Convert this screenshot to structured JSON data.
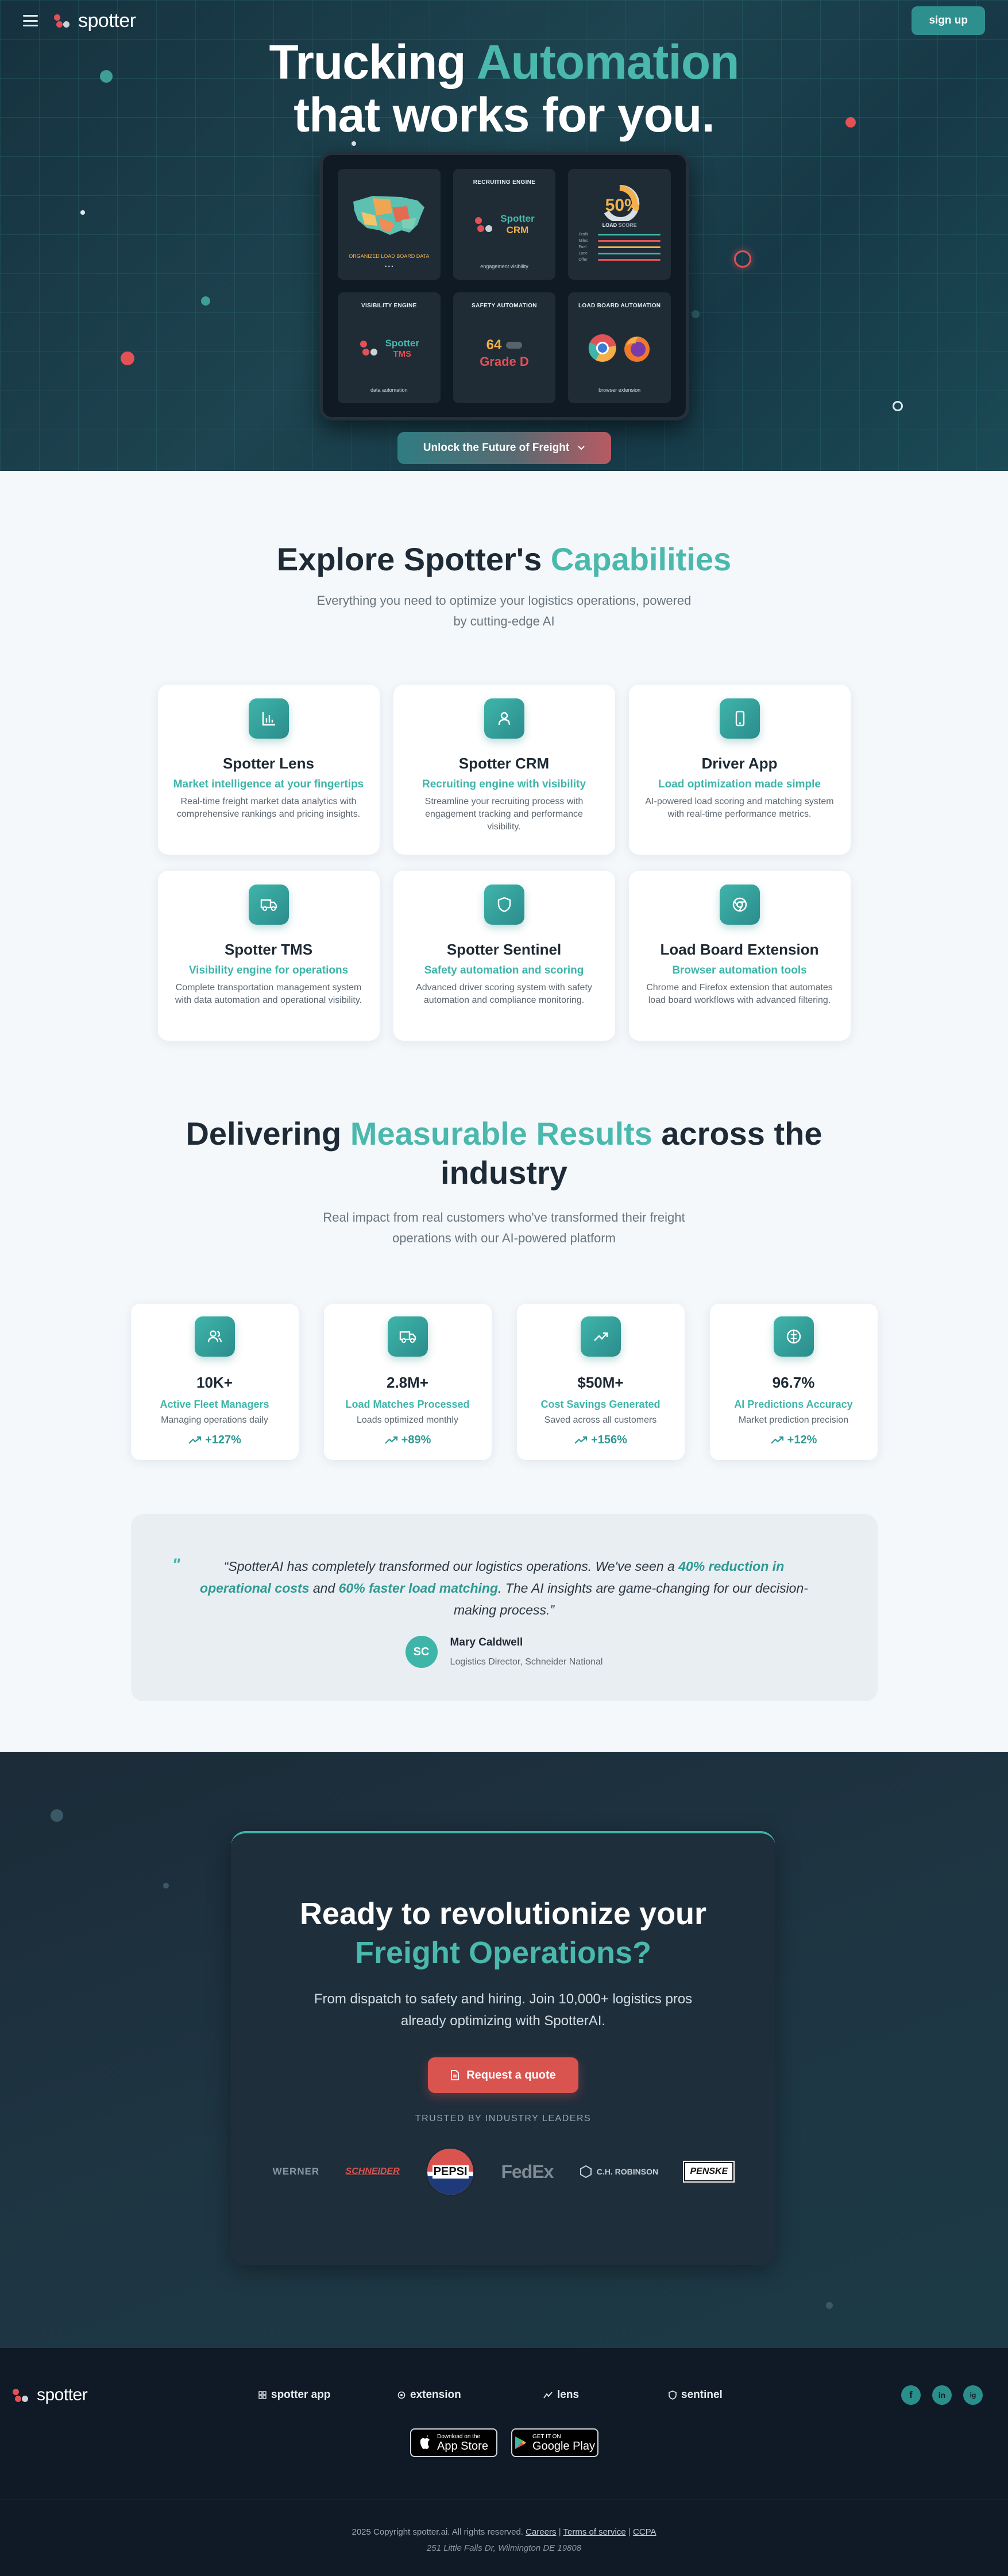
{
  "header": {
    "brand": "spotter",
    "signup_label": "sign up"
  },
  "hero": {
    "title_line1_plain": "Trucking ",
    "title_line1_accent": "Automation",
    "title_line2": "that works for you.",
    "cta_label": "Unlock the Future of Freight",
    "tablet_cards": [
      {
        "title": "",
        "foot": "ORGANIZED LOAD BOARD DATA",
        "foot2": "• • •"
      },
      {
        "title": "RECRUITING ENGINE",
        "logo_a": "Spotter",
        "logo_b": "CRM",
        "foot": "engagement visibility"
      },
      {
        "title": "",
        "pct": "50%",
        "load_label": "LOAD",
        "score_label": "SCORE",
        "rows": [
          "Profit",
          "Miles",
          "Fuel",
          "Lane",
          "Offer"
        ]
      },
      {
        "title": "VISIBILITY ENGINE",
        "logo_a": "Spotter",
        "logo_b": "TMS",
        "foot": "data automation"
      },
      {
        "title": "SAFETY AUTOMATION",
        "score": "64",
        "grade": "Grade D"
      },
      {
        "title": "LOAD BOARD AUTOMATION",
        "foot": "browser extension"
      }
    ]
  },
  "capabilities": {
    "title_plain": "Explore Spotter's ",
    "title_accent": "Capabilities",
    "subtitle_line1": "Everything you need to optimize your logistics operations, powered",
    "subtitle_line2": "by cutting-edge AI",
    "cards": [
      {
        "name": "Spotter Lens",
        "tag": "Market intelligence at your fingertips",
        "desc": "Real-time freight market data analytics with comprehensive rankings and pricing insights.",
        "icon": "bar-chart-icon"
      },
      {
        "name": "Spotter CRM",
        "tag": "Recruiting engine with visibility",
        "desc": "Streamline your recruiting process with engagement tracking and performance visibility.",
        "icon": "user-icon"
      },
      {
        "name": "Driver App",
        "tag": "Load optimization made simple",
        "desc": "AI-powered load scoring and matching system with real-time performance metrics.",
        "icon": "phone-icon"
      },
      {
        "name": "Spotter TMS",
        "tag": "Visibility engine for operations",
        "desc": "Complete transportation management system with data automation and operational visibility.",
        "icon": "truck-icon"
      },
      {
        "name": "Spotter Sentinel",
        "tag": "Safety automation and scoring",
        "desc": "Advanced driver scoring system with safety automation and compliance monitoring.",
        "icon": "shield-icon"
      },
      {
        "name": "Load Board Extension",
        "tag": "Browser automation tools",
        "desc": "Chrome and Firefox extension that automates load board workflows with advanced filtering.",
        "icon": "chrome-icon"
      }
    ]
  },
  "results": {
    "title_plain1": "Delivering ",
    "title_accent": "Measurable Results",
    "title_plain2": " across the",
    "title_line2": "industry",
    "subtitle_line1": "Real impact from real customers who've transformed their freight",
    "subtitle_line2": "operations with our AI-powered platform",
    "stats": [
      {
        "value": "10K+",
        "label": "Active Fleet Managers",
        "desc": "Managing operations daily",
        "trend": "+127%",
        "icon": "users-icon"
      },
      {
        "value": "2.8M+",
        "label": "Load Matches Processed",
        "desc": "Loads optimized monthly",
        "trend": "+89%",
        "icon": "truck-icon"
      },
      {
        "value": "$50M+",
        "label": "Cost Savings Generated",
        "desc": "Saved across all customers",
        "trend": "+156%",
        "icon": "trending-up-icon"
      },
      {
        "value": "96.7%",
        "label": "AI Predictions Accuracy",
        "desc": "Market prediction precision",
        "trend": "+12%",
        "icon": "brain-icon"
      }
    ],
    "testimonial": {
      "mark": "\"",
      "part1": "“SpotterAI has completely transformed our logistics operations. We've seen a ",
      "highlight1": "40% reduction in operational costs",
      "part2": " and ",
      "highlight2": "60% faster load matching",
      "part3": ". The AI insights are game-changing for our decision-making process.”",
      "initials": "SC",
      "author": "Mary Caldwell",
      "role": "Logistics Director, Schneider National"
    }
  },
  "cta": {
    "title_line1": "Ready to revolutionize your",
    "title_line2": "Freight Operations?",
    "sub_line1": "From dispatch to safety and hiring. Join 10,000+ logistics pros",
    "sub_line2": "already optimizing with SpotterAI.",
    "button_label": "Request a quote",
    "trusted_label": "TRUSTED BY INDUSTRY LEADERS",
    "partners": [
      "WERNER",
      "SCHNEIDER",
      "PEPSI",
      "FedEx",
      "C.H. ROBINSON",
      "PENSKE"
    ]
  },
  "footer": {
    "brand": "spotter",
    "links": [
      "spotter app",
      "extension",
      "lens",
      "sentinel"
    ],
    "socials": [
      "f",
      "in",
      "ig"
    ],
    "appstore_small": "Download on the",
    "appstore_big": "App Store",
    "gplay_small": "GET IT ON",
    "gplay_big": "Google Play",
    "copyright_prefix": "2025 Copyright spotter.ai. All rights reserved. ",
    "careers": "Careers",
    "terms": "Terms of service",
    "ccpa": "CCPA",
    "address": "251 Little Falls Dr, Wilmington DE 19808"
  },
  "colors": {
    "accent": "#3fb5aa",
    "danger": "#d9534f",
    "navy": "#1e2a35"
  }
}
